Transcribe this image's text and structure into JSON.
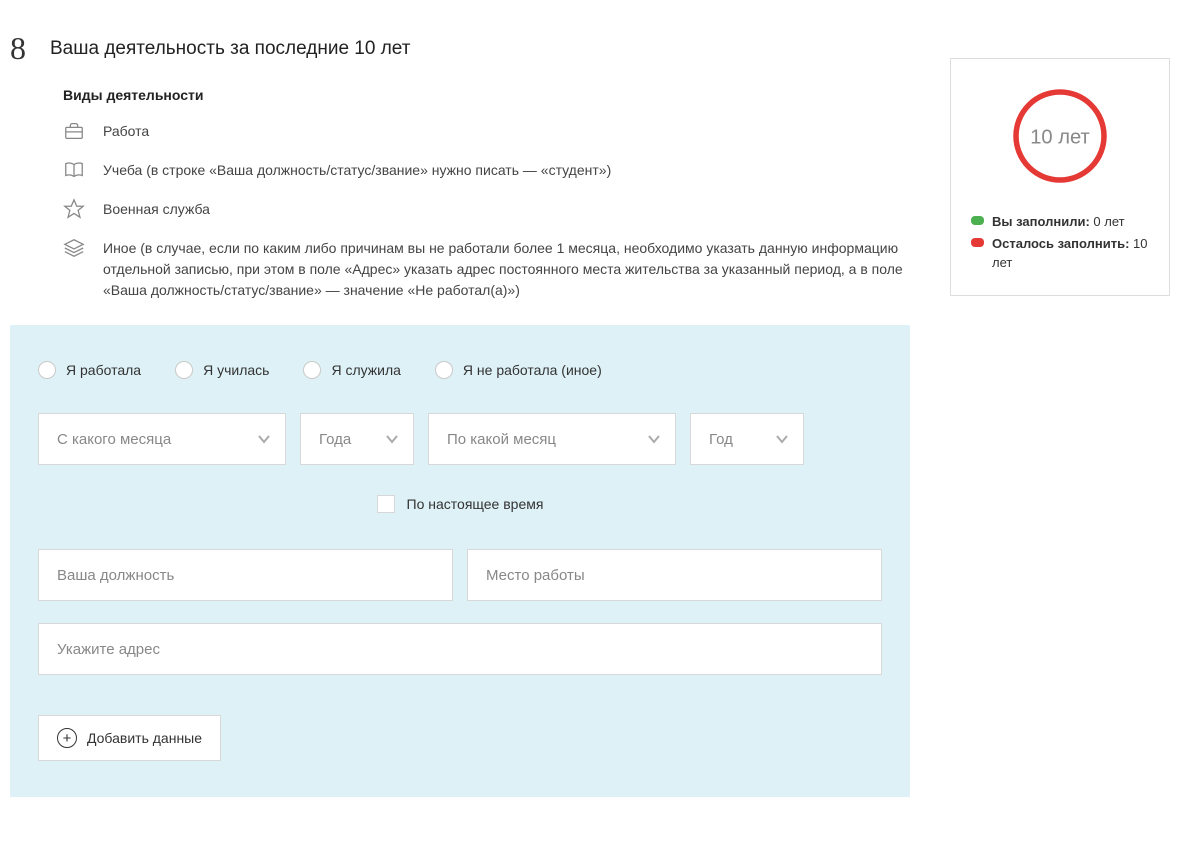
{
  "header": {
    "step": "8",
    "title": "Ваша деятельность за последние 10 лет"
  },
  "subtitle": "Виды деятельности",
  "activities": {
    "work": "Работа",
    "study": "Учеба (в строке «Ваша должность/статус/звание» нужно писать — «студент»)",
    "military": "Военная служба",
    "other": "Иное (в случае, если по каким либо причинам вы не работали более 1 месяца, необходимо указать данную информацию отдельной записью, при этом в поле «Адрес» указать адрес постоянного места жительства за указанный период, а в поле «Ваша должность/статус/звание» — значение «Не работал(а)»)"
  },
  "form": {
    "radios": {
      "worked": "Я работала",
      "studied": "Я училась",
      "served": "Я служила",
      "none": "Я не работала (иное)"
    },
    "selects": {
      "from_month": "С какого месяца",
      "from_year": "Года",
      "to_month": "По какой месяц",
      "to_year": "Год"
    },
    "checkbox_present": "По настоящее время",
    "inputs": {
      "position": "Ваша должность",
      "workplace": "Место работы",
      "address": "Укажите адрес"
    },
    "add_button": "Добавить данные"
  },
  "progress": {
    "ring_label": "10 лет",
    "filled_label": "Вы заполнили:",
    "filled_value": "0 лет",
    "remaining_label": "Осталось заполнить:",
    "remaining_value": "10 лет"
  }
}
